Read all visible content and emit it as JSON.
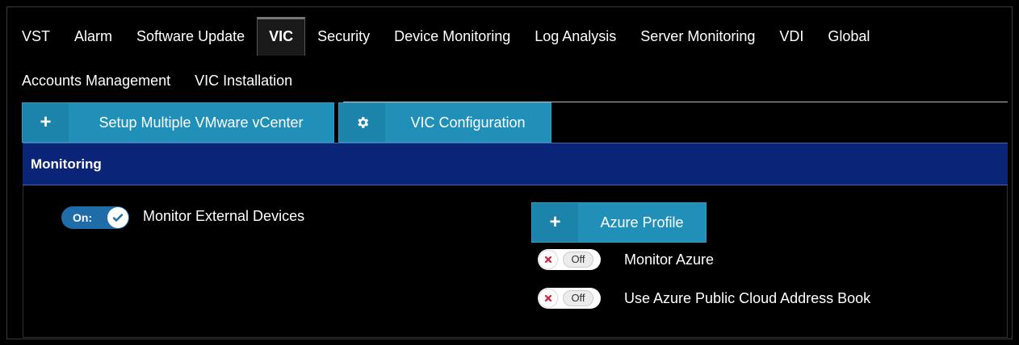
{
  "tabs_row1": [
    "VST",
    "Alarm",
    "Software Update",
    "VIC",
    "Security",
    "Device Monitoring",
    "Log Analysis",
    "Server Monitoring",
    "VDI",
    "Global"
  ],
  "tabs_row2": [
    "Accounts Management",
    "VIC Installation"
  ],
  "active_tab": "VIC",
  "actions": {
    "setup_vcenter": {
      "icon": "plus-icon",
      "label": "Setup Multiple VMware vCenter"
    },
    "vic_configuration": {
      "icon": "gear-icon",
      "label": "VIC Configuration"
    }
  },
  "panel": {
    "title": "Monitoring",
    "monitor_external": {
      "state": "On:",
      "label": "Monitor External Devices"
    },
    "azure_profile": {
      "icon": "plus-icon",
      "label": "Azure Profile"
    },
    "monitor_azure": {
      "state": "Off",
      "label": "Monitor Azure"
    },
    "azure_address_book": {
      "state": "Off",
      "label": "Use Azure Public Cloud Address Book"
    }
  },
  "colors": {
    "button": "#1c84aa",
    "panel_header": "#0a2478",
    "toggle_on": "#1e6da8",
    "toggle_off_x": "#d0203a"
  }
}
